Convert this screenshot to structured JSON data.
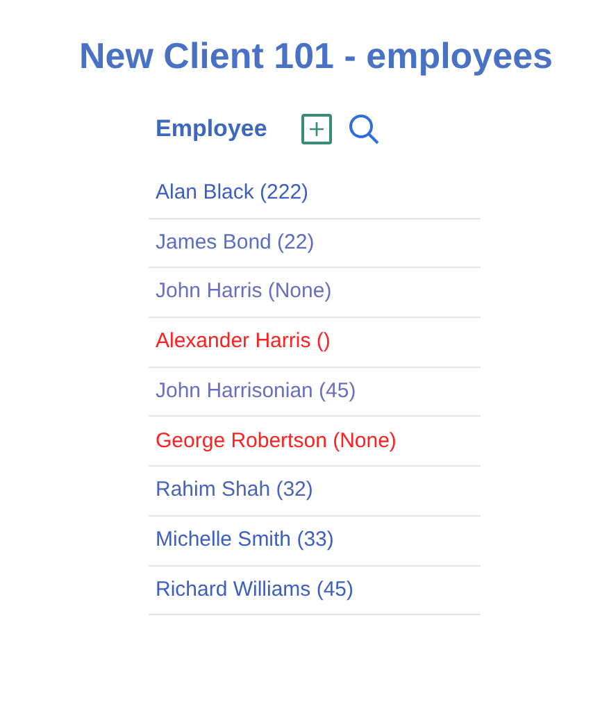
{
  "title": "New Client 101 - employees",
  "header": {
    "label": "Employee"
  },
  "employees": [
    {
      "label": "Alan Black (222)",
      "color": "#3d5fbf"
    },
    {
      "label": "James Bond (22)",
      "color": "#5a6fc4"
    },
    {
      "label": "John Harris (None)",
      "color": "#6a6fbf"
    },
    {
      "label": "Alexander Harris ()",
      "color": "#ff2020"
    },
    {
      "label": "John Harrisonian (45)",
      "color": "#6a6fbf"
    },
    {
      "label": "George Robertson (None)",
      "color": "#ff2020"
    },
    {
      "label": "Rahim Shah (32)",
      "color": "#4a64b8"
    },
    {
      "label": "Michelle Smith (33)",
      "color": "#3d5fbf"
    },
    {
      "label": "Richard Williams (45)",
      "color": "#3d5fbf"
    }
  ]
}
